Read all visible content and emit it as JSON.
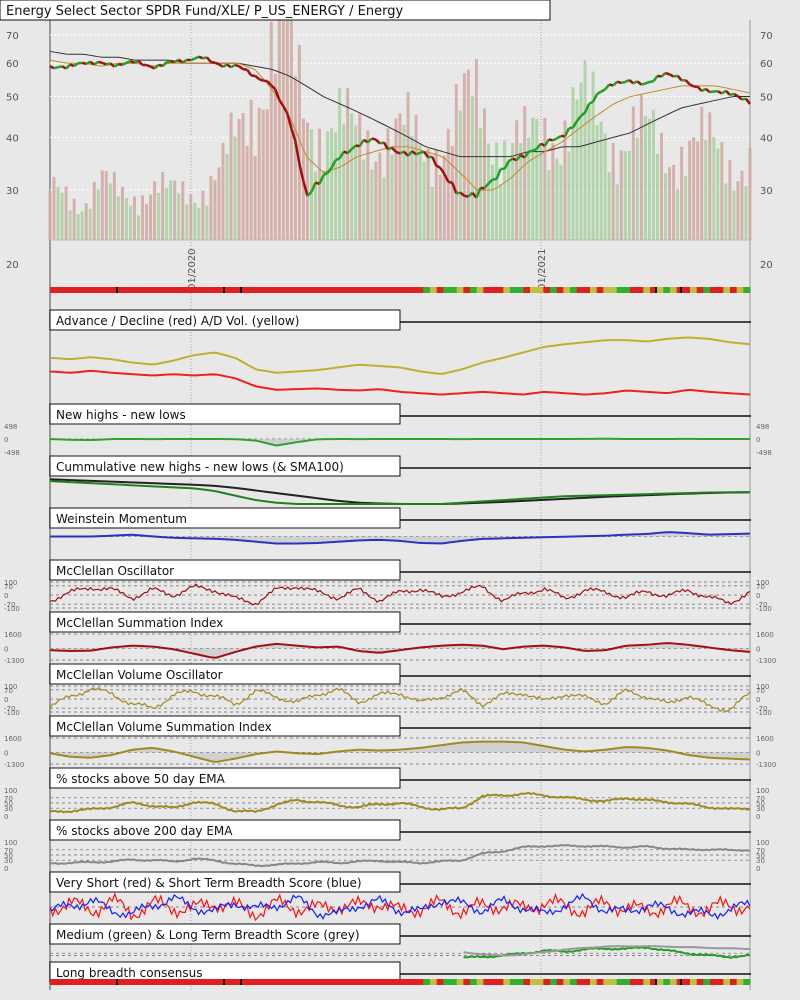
{
  "title": "Energy Select Sector SPDR Fund/XLE/ P_US_ENERGY / Energy",
  "chart_data": {
    "type": "line",
    "x_labels": [
      "01/2020",
      "01/2021"
    ],
    "price": {
      "axis_ticks": [
        70,
        60,
        50,
        40,
        30,
        20
      ],
      "ylim": [
        20,
        70
      ],
      "close": [
        59,
        58,
        60,
        61,
        59,
        60,
        59,
        61,
        60,
        62,
        60,
        59,
        55,
        54,
        45,
        28,
        32,
        37,
        38,
        39,
        38,
        37,
        36,
        33,
        30,
        29,
        31,
        36,
        37,
        38,
        40,
        45,
        50,
        53,
        55,
        54,
        56,
        55,
        53,
        51,
        50,
        49
      ],
      "sma50": [
        61,
        60,
        60,
        59,
        60,
        60,
        59,
        60,
        60,
        60,
        60,
        60,
        58,
        52,
        45,
        36,
        33,
        34,
        36,
        37,
        38,
        38,
        37,
        36,
        33,
        30,
        30,
        32,
        35,
        37,
        39,
        42,
        45,
        48,
        50,
        51,
        52,
        53,
        53,
        53,
        52,
        51
      ],
      "sma200": [
        64,
        63,
        63,
        62,
        62,
        61,
        61,
        61,
        60,
        60,
        60,
        60,
        59,
        58,
        56,
        53,
        50,
        48,
        46,
        44,
        42,
        40,
        38,
        37,
        36,
        36,
        36,
        36,
        37,
        37,
        38,
        38,
        39,
        40,
        41,
        43,
        45,
        47,
        48,
        49,
        50,
        50
      ],
      "volume": [
        20,
        22,
        18,
        25,
        20,
        22,
        24,
        20,
        22,
        25,
        30,
        45,
        70,
        90,
        80,
        60,
        55,
        50,
        45,
        50,
        48,
        45,
        40,
        50,
        55,
        60,
        52,
        45,
        40,
        50,
        55,
        60,
        52,
        48,
        50,
        45,
        40,
        45,
        42,
        40,
        38,
        36
      ]
    },
    "top_strip": "RRRRRRRRRRRRRRRRRRRRRRRRRRRRRRRRRRRRRRRRRRRRRRRRRRRRRRRRGYRGGYRGYRRRYGGRYYRGRYGRRYRYYGGRRYRYGYRRYRGRRYRYG",
    "panels": [
      {
        "title": "Advance / Decline (red) A/D Vol. (yellow)",
        "ylim": [
          0,
          100
        ],
        "labels": [],
        "refs": [],
        "series": [
          {
            "name": "ad-volume",
            "color": "#c0b030",
            "values": [
              62,
              60,
              63,
              60,
              55,
              52,
              58,
              66,
              70,
              62,
              45,
              40,
              42,
              44,
              48,
              52,
              50,
              48,
              42,
              38,
              45,
              55,
              62,
              70,
              78,
              82,
              85,
              88,
              88,
              86,
              90,
              92,
              90,
              85,
              82
            ]
          },
          {
            "name": "advance-decline",
            "color": "#ee2020",
            "values": [
              42,
              40,
              43,
              40,
              38,
              36,
              38,
              36,
              38,
              32,
              20,
              15,
              16,
              17,
              15,
              14,
              16,
              12,
              10,
              8,
              10,
              12,
              10,
              8,
              12,
              10,
              8,
              10,
              14,
              12,
              10,
              15,
              12,
              10,
              8
            ]
          }
        ]
      },
      {
        "title": "New highs - new lows",
        "ylim": [
          -498,
          498
        ],
        "labels": [
          "498",
          "0",
          "-498"
        ],
        "refs": [
          0
        ],
        "series": [
          {
            "name": "new-highs-lows",
            "color": "#30a030",
            "values": [
              0,
              -30,
              -40,
              0,
              0,
              -5,
              0,
              0,
              0,
              -5,
              -60,
              -250,
              -120,
              -10,
              0,
              -5,
              0,
              0,
              0,
              0,
              -5,
              0,
              0,
              0,
              0,
              0,
              5,
              10,
              0,
              0,
              0,
              5,
              0,
              0,
              0
            ]
          }
        ]
      },
      {
        "title": "Cummulative new highs - new lows (& SMA100)",
        "ylim": [
          0,
          100
        ],
        "labels": [],
        "refs": [],
        "series": [
          {
            "name": "sma100",
            "color": "#222222",
            "values": [
              95,
              92,
              89,
              86,
              83,
              80,
              77,
              74,
              70,
              62,
              52,
              42,
              32,
              22,
              12,
              5,
              2,
              0,
              0,
              0,
              2,
              5,
              8,
              12,
              16,
              20,
              24,
              28,
              31,
              34,
              37,
              40,
              42,
              44,
              45
            ]
          },
          {
            "name": "cumulative-nhnl",
            "color": "#208020",
            "values": [
              88,
              84,
              80,
              76,
              72,
              68,
              64,
              60,
              50,
              32,
              15,
              5,
              0,
              0,
              0,
              0,
              0,
              0,
              0,
              0,
              5,
              10,
              15,
              20,
              25,
              30,
              32,
              34,
              36,
              38,
              40,
              42,
              44,
              45,
              46
            ]
          }
        ]
      },
      {
        "title": "Weinstein Momentum",
        "ylim": [
          0,
          100
        ],
        "labels": [],
        "refs": [
          75
        ],
        "series": [
          {
            "name": "weinstein-momentum",
            "color": "#3030c0",
            "values": [
              75,
              75,
              75,
              78,
              82,
              75,
              70,
              68,
              66,
              62,
              55,
              48,
              48,
              50,
              55,
              60,
              62,
              58,
              50,
              48,
              58,
              66,
              68,
              70,
              72,
              74,
              76,
              78,
              82,
              85,
              92,
              88,
              82,
              84,
              86
            ]
          }
        ]
      },
      {
        "title": "McClellan Oscillator",
        "ylim": [
          -100,
          100
        ],
        "labels": [
          "100",
          "70",
          "0",
          "-70",
          "-100"
        ],
        "refs": [
          100,
          70,
          0,
          -70,
          -100
        ],
        "series": [
          {
            "name": "mcclellan-oscillator",
            "color": "#a01010",
            "noise": 25,
            "values": [
              -40,
              20,
              60,
              40,
              -20,
              40,
              0,
              60,
              40,
              -30,
              -60,
              40,
              70,
              20,
              -20,
              40,
              -40,
              20,
              50,
              -20,
              30,
              60,
              -40,
              10,
              50,
              -30,
              40,
              20,
              -20,
              30,
              -10,
              40,
              -20,
              -60,
              20
            ]
          }
        ]
      },
      {
        "title": "McClellan Summation Index",
        "ylim": [
          -1300,
          1600
        ],
        "labels": [
          "1600",
          "0",
          "-1300"
        ],
        "refs": [
          1600,
          0,
          -1300
        ],
        "series": [
          {
            "name": "mcclellan-summation",
            "color": "#a01010",
            "values": [
              -200,
              -300,
              -250,
              100,
              300,
              200,
              -100,
              -600,
              -1100,
              -400,
              200,
              500,
              300,
              100,
              200,
              -300,
              -500,
              -200,
              100,
              300,
              400,
              300,
              -100,
              200,
              300,
              100,
              -300,
              -200,
              300,
              400,
              600,
              400,
              100,
              -200,
              -400
            ]
          }
        ]
      },
      {
        "title": "McClellan Volume Oscillator",
        "ylim": [
          -100,
          100
        ],
        "labels": [
          "100",
          "70",
          "0",
          "-70",
          "-100"
        ],
        "refs": [
          100,
          70,
          0,
          -70,
          -100
        ],
        "series": [
          {
            "name": "mcclellan-volume-oscillator",
            "color": "#a08a20",
            "noise": 25,
            "values": [
              -60,
              20,
              80,
              40,
              -40,
              -70,
              30,
              60,
              20,
              -40,
              60,
              20,
              -30,
              40,
              70,
              -20,
              30,
              50,
              -30,
              20,
              60,
              -40,
              30,
              50,
              -20,
              40,
              10,
              -30,
              60,
              20,
              -40,
              30,
              -60,
              -80,
              40
            ]
          }
        ]
      },
      {
        "title": "McClellan Volume Summation Index",
        "ylim": [
          -1300,
          1600
        ],
        "labels": [
          "1600",
          "0",
          "-1300"
        ],
        "refs": [
          1600,
          0,
          -1300
        ],
        "series": [
          {
            "name": "mcclellan-volume-summation",
            "color": "#a08a20",
            "values": [
              -100,
              -500,
              -600,
              -300,
              300,
              500,
              100,
              -500,
              -1100,
              -700,
              -200,
              100,
              -100,
              -200,
              100,
              300,
              200,
              300,
              500,
              800,
              1100,
              1200,
              1200,
              1100,
              700,
              300,
              100,
              300,
              600,
              500,
              200,
              -300,
              -600,
              -700,
              -800
            ]
          }
        ]
      },
      {
        "title": "% stocks above 50 day EMA",
        "ylim": [
          0,
          100
        ],
        "labels": [
          "100",
          "70",
          "50",
          "30",
          "0"
        ],
        "refs": [
          70,
          50,
          30
        ],
        "series": [
          {
            "name": "pct-above-50ema",
            "color": "#a08a20",
            "noise": 6,
            "values": [
              15,
              20,
              25,
              35,
              50,
              40,
              30,
              55,
              45,
              20,
              15,
              45,
              60,
              55,
              40,
              35,
              45,
              50,
              35,
              25,
              30,
              75,
              80,
              85,
              80,
              70,
              65,
              55,
              70,
              60,
              55,
              45,
              35,
              25,
              30
            ]
          }
        ]
      },
      {
        "title": "% stocks above 200 day EMA",
        "ylim": [
          0,
          100
        ],
        "labels": [
          "100",
          "70",
          "50",
          "30",
          "0"
        ],
        "refs": [
          70,
          50,
          30
        ],
        "series": [
          {
            "name": "pct-above-200ema",
            "color": "#888888",
            "noise": 4,
            "values": [
              18,
              20,
              22,
              25,
              32,
              30,
              25,
              35,
              30,
              15,
              10,
              12,
              18,
              22,
              20,
              25,
              28,
              22,
              20,
              25,
              30,
              55,
              65,
              80,
              85,
              85,
              85,
              82,
              80,
              82,
              75,
              70,
              72,
              68,
              70
            ]
          }
        ]
      },
      {
        "title": "Very Short (red) & Short Term Breadth Score (blue)",
        "ylim": [
          0,
          100
        ],
        "labels": [],
        "refs": [
          50
        ],
        "series": [
          {
            "name": "very-short-breadth",
            "color": "#ff1010",
            "noise": 40,
            "values": [
              50,
              60,
              40,
              70,
              30,
              60,
              50,
              40,
              70,
              50,
              30,
              60,
              50,
              40,
              60,
              50,
              70,
              30,
              50,
              60,
              40,
              50,
              60,
              40,
              70,
              50,
              40,
              60,
              50,
              30,
              60,
              50,
              40,
              60,
              50
            ]
          },
          {
            "name": "short-breadth",
            "color": "#1020ff",
            "noise": 25,
            "values": [
              30,
              60,
              70,
              40,
              20,
              60,
              80,
              50,
              30,
              70,
              40,
              60,
              80,
              30,
              20,
              60,
              70,
              40,
              30,
              80,
              60,
              40,
              70,
              50,
              20,
              60,
              80,
              40,
              30,
              60,
              40,
              30,
              20,
              40,
              60
            ]
          }
        ]
      },
      {
        "title": "Medium (green) & Long Term Breadth Score (grey)",
        "ylim": [
          0,
          100
        ],
        "labels": [],
        "refs": [
          40,
          20
        ],
        "series": [
          {
            "name": "medium-breadth",
            "color": "#20a020",
            "noise": 10,
            "values": [
              null,
              null,
              null,
              null,
              null,
              null,
              null,
              null,
              null,
              null,
              null,
              null,
              null,
              null,
              null,
              null,
              null,
              null,
              null,
              null,
              0,
              10,
              20,
              40,
              60,
              55,
              70,
              80,
              75,
              90,
              60,
              40,
              20,
              10,
              20
            ]
          },
          {
            "name": "long-breadth",
            "color": "#999999",
            "noise": 3,
            "values": [
              null,
              null,
              null,
              null,
              null,
              null,
              null,
              null,
              null,
              null,
              null,
              null,
              null,
              null,
              null,
              null,
              null,
              null,
              null,
              null,
              50,
              30,
              20,
              30,
              50,
              70,
              85,
              95,
              98,
              98,
              95,
              90,
              85,
              80,
              75
            ]
          }
        ]
      },
      {
        "title": "Long breadth consensus",
        "ylim": [
          0,
          100
        ],
        "labels": [],
        "refs": [],
        "series": []
      }
    ],
    "bottom_strip": "RRRRRRRRRRRRRRRRRRRRRRRRRRRRRRRRRRRRRRRRRRRRRRRRRRRRRRRRGYRGGYRGYRRRYGGRYYRGRYGRRYRYYGGRRYRYGYRRYRGRRYRYG"
  },
  "colors": {
    "up": "#20a020",
    "down": "#a01010",
    "sma50": "#c08a30",
    "sma200": "#333333",
    "strip_red": "#e02020",
    "strip_green": "#30b030",
    "strip_yellow": "#c0c040"
  }
}
